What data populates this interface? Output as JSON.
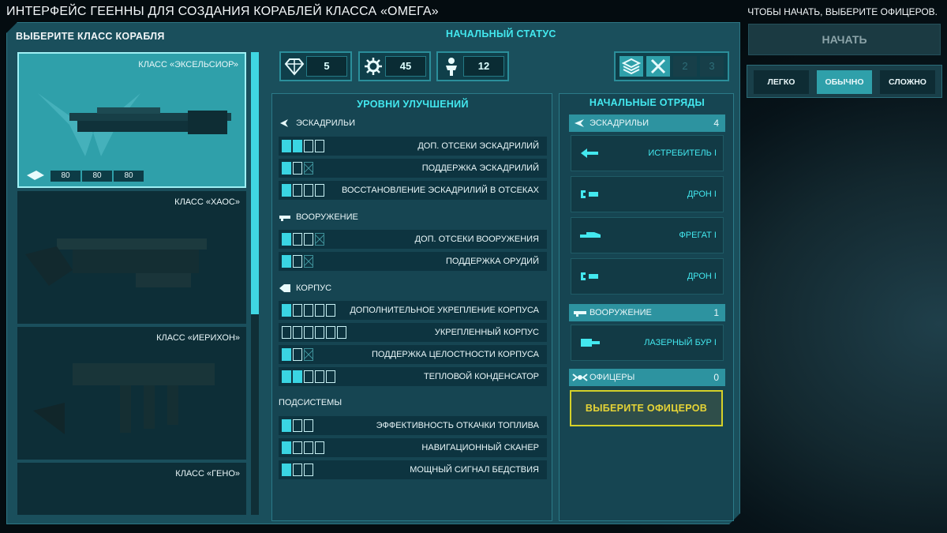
{
  "header": {
    "title": "ИНТЕРФЕЙС ГЕЕННЫ ДЛЯ СОЗДАНИЯ КОРАБЛЕЙ КЛАССА «ОМЕГА»",
    "hint": "ЧТОБЫ НАЧАТЬ, ВЫБЕРИТЕ ОФИЦЕРОВ."
  },
  "ship_select": {
    "title": "ВЫБЕРИТЕ КЛАСС КОРАБЛЯ",
    "ships": [
      {
        "name": "КЛАСС «ЭКСЕЛЬСИОР»",
        "selected": true,
        "stats": [
          "80",
          "80",
          "80"
        ]
      },
      {
        "name": "КЛАСС «ХАОС»",
        "selected": false
      },
      {
        "name": "КЛАСС «ИЕРИХОН»",
        "selected": false
      },
      {
        "name": "КЛАСС «ГЕНО»",
        "selected": false
      }
    ]
  },
  "status": {
    "title": "НАЧАЛЬНЫЙ СТАТУС",
    "resources": [
      {
        "icon": "cubes-icon",
        "value": "5"
      },
      {
        "icon": "gear-icon",
        "value": "45"
      },
      {
        "icon": "crew-icon",
        "value": "12"
      }
    ],
    "tools": [
      {
        "icon": "layers-icon"
      },
      {
        "icon": "tools-icon"
      },
      {
        "value": "2"
      },
      {
        "value": "3"
      }
    ]
  },
  "upgrades": {
    "title": "УРОВНИ УЛУЧШЕНИЙ",
    "sections": [
      {
        "name": "ЭСКАДРИЛЬИ",
        "rows": [
          {
            "label": "ДОП. ОТСЕКИ ЭСКАДРИЛИЙ",
            "pips": [
              "on",
              "on",
              "off",
              "off"
            ]
          },
          {
            "label": "ПОДДЕРЖКА ЭСКАДРИЛИЙ",
            "pips": [
              "on",
              "off",
              "x"
            ]
          },
          {
            "label": "ВОССТАНОВЛЕНИЕ ЭСКАДРИЛИЙ В ОТСЕКАХ",
            "pips": [
              "on",
              "off",
              "off",
              "off"
            ]
          }
        ]
      },
      {
        "name": "ВООРУЖЕНИЕ",
        "rows": [
          {
            "label": "ДОП. ОТСЕКИ ВООРУЖЕНИЯ",
            "pips": [
              "on",
              "off",
              "off",
              "x"
            ]
          },
          {
            "label": "ПОДДЕРЖКА ОРУДИЙ",
            "pips": [
              "on",
              "off",
              "x"
            ]
          }
        ]
      },
      {
        "name": "КОРПУС",
        "rows": [
          {
            "label": "ДОПОЛНИТЕЛЬНОЕ УКРЕПЛЕНИЕ КОРПУСА",
            "pips": [
              "on",
              "off",
              "off",
              "off",
              "off"
            ]
          },
          {
            "label": "УКРЕПЛЕННЫЙ КОРПУС",
            "pips": [
              "off",
              "off",
              "off",
              "off",
              "off",
              "off"
            ]
          },
          {
            "label": "ПОДДЕРЖКА ЦЕЛОСТНОСТИ КОРПУСА",
            "pips": [
              "on",
              "off",
              "x"
            ]
          },
          {
            "label": "ТЕПЛОВОЙ КОНДЕНСАТОР",
            "pips": [
              "on",
              "on",
              "off",
              "off",
              "off"
            ]
          }
        ]
      },
      {
        "name": "ПОДСИСТЕМЫ",
        "rows": [
          {
            "label": "ЭФФЕКТИВНОСТЬ ОТКАЧКИ ТОПЛИВА",
            "pips": [
              "on",
              "off",
              "off"
            ]
          },
          {
            "label": "НАВИГАЦИОННЫЙ СКАНЕР",
            "pips": [
              "on",
              "off",
              "off",
              "off"
            ]
          },
          {
            "label": "МОЩНЫЙ СИГНАЛ БЕДСТВИЯ",
            "pips": [
              "on",
              "off",
              "off"
            ]
          }
        ]
      }
    ]
  },
  "squads": {
    "title": "НАЧАЛЬНЫЕ ОТРЯДЫ",
    "squadrons": {
      "label": "ЭСКАДРИЛЬИ",
      "count": "4",
      "items": [
        "ИСТРЕБИТЕЛЬ I",
        "ДРОН I",
        "ФРЕГАТ I",
        "ДРОН I"
      ]
    },
    "weapons": {
      "label": "ВООРУЖЕНИЕ",
      "count": "1",
      "items": [
        "ЛАЗЕРНЫЙ БУР I"
      ]
    },
    "officers": {
      "label": "ОФИЦЕРЫ",
      "count": "0",
      "button": "ВЫБЕРИТЕ ОФИЦЕРОВ"
    }
  },
  "controls": {
    "start": "НАЧАТЬ",
    "difficulty": [
      "ЛЕГКО",
      "ОБЫЧНО",
      "СЛОЖНО"
    ],
    "difficulty_selected": "ОБЫЧНО"
  },
  "colors": {
    "accent": "#43e8ef",
    "panel": "#1a4f5c",
    "highlight": "#d5d128",
    "selected": "#2fa0aa"
  }
}
